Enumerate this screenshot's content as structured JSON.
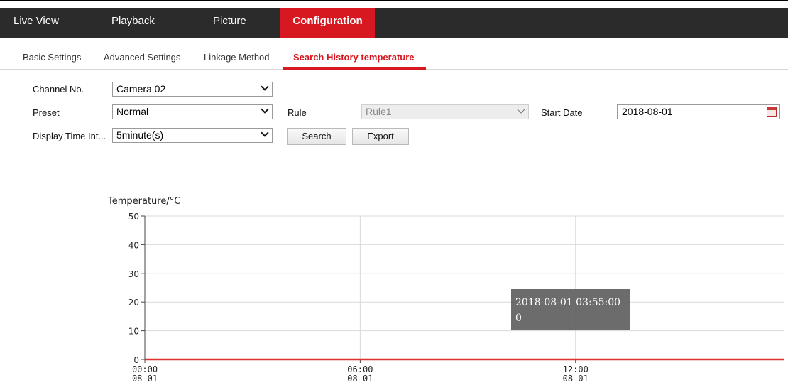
{
  "nav": {
    "items": [
      {
        "label": "Live View"
      },
      {
        "label": "Playback"
      },
      {
        "label": "Picture"
      },
      {
        "label": "Configuration"
      }
    ]
  },
  "tabs": [
    {
      "label": "Basic Settings"
    },
    {
      "label": "Advanced Settings"
    },
    {
      "label": "Linkage Method"
    },
    {
      "label": "Search History temperature"
    }
  ],
  "form": {
    "channel_label": "Channel No.",
    "channel_value": "Camera 02",
    "preset_label": "Preset",
    "preset_value": "Normal",
    "rule_label": "Rule",
    "rule_value": "Rule1",
    "start_date_label": "Start Date",
    "start_date_value": "2018-08-01",
    "interval_label": "Display Time Int...",
    "interval_value": "5minute(s)",
    "search_label": "Search",
    "export_label": "Export"
  },
  "tooltip": {
    "time": "2018-08-01 03:55:00",
    "value": "0"
  },
  "chart_data": {
    "type": "line",
    "title": "",
    "ylabel": "Temperature/°C",
    "xlabel": "",
    "ylim": [
      0,
      50
    ],
    "yticks": [
      0,
      10,
      20,
      30,
      40,
      50
    ],
    "xticks": [
      {
        "label": "00:00",
        "sublabel": "08-01",
        "hour": 0
      },
      {
        "label": "06:00",
        "sublabel": "08-01",
        "hour": 6
      },
      {
        "label": "12:00",
        "sublabel": "08-01",
        "hour": 12
      }
    ],
    "x_range_hours": [
      0,
      17.8
    ],
    "series": [
      {
        "color": "#e03030",
        "x": [
          0,
          17.8
        ],
        "values": [
          0,
          0
        ]
      }
    ],
    "grid": true
  }
}
